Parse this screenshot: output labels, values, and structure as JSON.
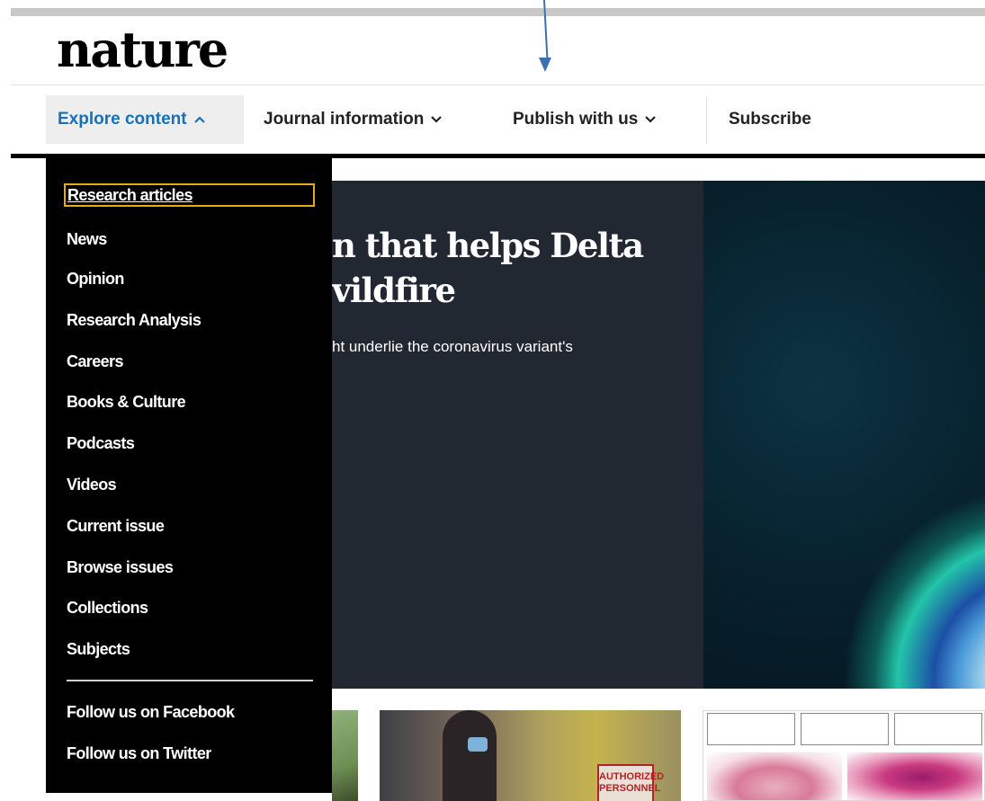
{
  "site": {
    "logo": "nature"
  },
  "nav": {
    "explore": "Explore content",
    "journal": "Journal information",
    "publish": "Publish with us",
    "subscribe": "Subscribe"
  },
  "menu": {
    "items": [
      "Research articles",
      "News",
      "Opinion",
      "Research Analysis",
      "Careers",
      "Books & Culture",
      "Podcasts",
      "Videos",
      "Current issue",
      "Browse issues",
      "Collections",
      "Subjects"
    ],
    "social": [
      "Follow us on Facebook",
      "Follow us on Twitter"
    ]
  },
  "hero": {
    "title": "n that helps Delta\nvildfire",
    "subtitle": "ht underlie the coronavirus variant's"
  },
  "cards": {
    "sign_text": "AUTHORIZED PERSONNEL"
  },
  "colors": {
    "accent": "#1a6fb5",
    "focus_outline": "#e8a914",
    "menu_bg": "#000000",
    "hero_bg": "#222831",
    "annotation_arrow": "#3f6fb0"
  },
  "icons": {
    "explore_caret": "chevron-up",
    "dropdown_caret": "chevron-down"
  }
}
